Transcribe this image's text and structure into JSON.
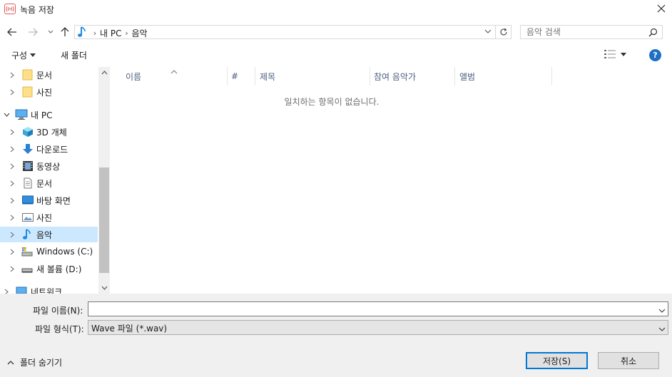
{
  "window": {
    "title": "녹음 저장"
  },
  "address": {
    "crumbs": [
      "내 PC",
      "음악"
    ]
  },
  "search": {
    "placeholder": "음악 검색"
  },
  "toolbar": {
    "organize_label": "구성",
    "new_folder_label": "새 폴더"
  },
  "help": {
    "label": "?"
  },
  "nav_tree": [
    {
      "label": "문서",
      "icon": "folder-icon",
      "level": 1,
      "selected": false
    },
    {
      "label": "사진",
      "icon": "folder-icon",
      "level": 1,
      "selected": false
    },
    {
      "label": "내 PC",
      "icon": "pc-icon",
      "level": 0,
      "expanded": true,
      "selected": false
    },
    {
      "label": "3D 개체",
      "icon": "3d-objects-icon",
      "level": 1,
      "selected": false
    },
    {
      "label": "다운로드",
      "icon": "download-icon",
      "level": 1,
      "selected": false
    },
    {
      "label": "동영상",
      "icon": "video-icon",
      "level": 1,
      "selected": false
    },
    {
      "label": "문서",
      "icon": "document-icon",
      "level": 1,
      "selected": false
    },
    {
      "label": "바탕 화면",
      "icon": "desktop-icon",
      "level": 1,
      "selected": false
    },
    {
      "label": "사진",
      "icon": "pictures-icon",
      "level": 1,
      "selected": false
    },
    {
      "label": "음악",
      "icon": "music-icon",
      "level": 1,
      "selected": true
    },
    {
      "label": "Windows (C:)",
      "icon": "drive-c-icon",
      "level": 1,
      "selected": false
    },
    {
      "label": "새 볼륨 (D:)",
      "icon": "drive-d-icon",
      "level": 1,
      "selected": false
    },
    {
      "label": "네트워크",
      "icon": "network-icon",
      "level": 0,
      "selected": false
    }
  ],
  "columns": [
    {
      "label": "이름"
    },
    {
      "label": "#"
    },
    {
      "label": "제목"
    },
    {
      "label": "참여 음악가"
    },
    {
      "label": "앨범"
    }
  ],
  "content": {
    "empty_message": "일치하는 항목이 없습니다."
  },
  "form": {
    "filename_label": "파일 이름(N):",
    "filename_value": "",
    "filetype_label": "파일 형식(T):",
    "filetype_value": "Wave 파일 (*.wav)"
  },
  "footer": {
    "hide_folders_label": "폴더 숨기기",
    "save_label": "저장(S)",
    "cancel_label": "취소"
  },
  "colors": {
    "selection": "#cce8ff",
    "accent": "#0078d7",
    "help": "#1f6fc5"
  }
}
